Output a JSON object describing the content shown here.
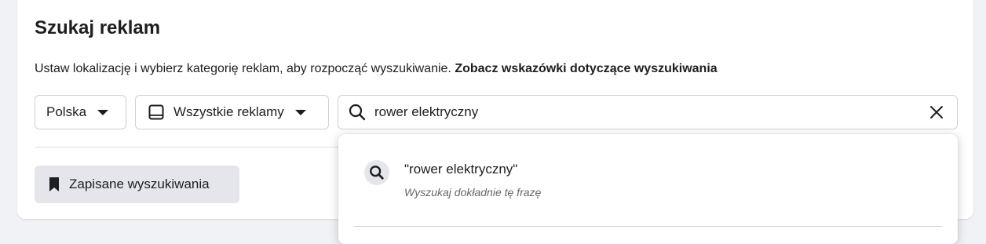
{
  "page": {
    "title": "Szukaj reklam",
    "description": "Ustaw lokalizację i wybierz kategorię reklam, aby rozpocząć wyszukiwanie.",
    "tips_link": "Zobacz wskazówki dotyczące wyszukiwania"
  },
  "filters": {
    "country": {
      "selected": "Polska",
      "icon": "caret-down-icon"
    },
    "ad_type": {
      "selected": "Wszystkie reklamy",
      "icon": "tablet-icon"
    }
  },
  "search": {
    "value": "rower elektryczny",
    "search_icon": "search-icon",
    "clear_icon": "close-icon"
  },
  "saved_searches": {
    "label": "Zapisane wyszukiwania",
    "icon": "bookmark-icon"
  },
  "suggestions": [
    {
      "text": "\"rower elektryczny\"",
      "subtext": "Wyszukaj dokładnie tę frazę",
      "icon": "search-icon"
    }
  ],
  "colors": {
    "background": "#f0f2f5",
    "card": "#ffffff",
    "border": "#ced0d4",
    "button_bg": "#e4e6eb",
    "text": "#1c1e21",
    "secondary_text": "#65676b"
  }
}
